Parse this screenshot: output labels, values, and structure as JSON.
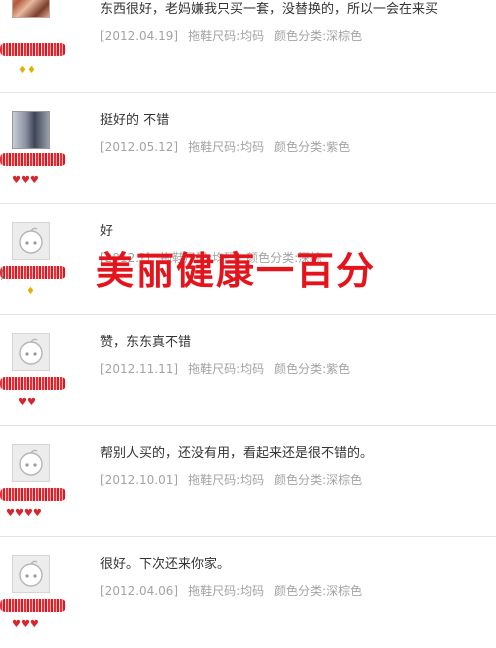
{
  "reviews": [
    {
      "content": "东西很好，老妈嫌我只买一套，没替换的，所以一会在来买",
      "date": "[2012.04.19]",
      "size": "拖鞋尺码:均码",
      "color": "颜色分类:深棕色",
      "avatar": "photo-hair",
      "rank_icon": "diamond-icon",
      "rank_count": 2,
      "rank_glyph": "♦♦",
      "rank_color": "#e2b100"
    },
    {
      "content": "挺好的 不错",
      "date": "[2012.05.12]",
      "size": "拖鞋尺码:均码",
      "color": "颜色分类:紫色",
      "avatar": "photo-room",
      "rank_icon": "heart-icon",
      "rank_count": 3,
      "rank_glyph": "♥♥♥",
      "rank_color": "#d8262d"
    },
    {
      "content": "好",
      "date": "[2012.?]",
      "size": "拖鞋尺码:均码",
      "color": "颜色分类:深棕",
      "avatar": "default",
      "rank_icon": "diamond-icon",
      "rank_count": 1,
      "rank_glyph": "♦",
      "rank_color": "#e2b100"
    },
    {
      "content": "赞，东东真不错",
      "date": "[2012.11.11]",
      "size": "拖鞋尺码:均码",
      "color": "颜色分类:紫色",
      "avatar": "default",
      "rank_icon": "heart-icon",
      "rank_count": 2,
      "rank_glyph": "♥♥",
      "rank_color": "#d8262d"
    },
    {
      "content": "帮别人买的，还没有用，看起来还是很不错的。",
      "date": "[2012.10.01]",
      "size": "拖鞋尺码:均码",
      "color": "颜色分类:深棕色",
      "avatar": "default",
      "rank_icon": "heart-icon",
      "rank_count": 4,
      "rank_glyph": "♥♥♥♥",
      "rank_color": "#d8262d"
    },
    {
      "content": "很好。下次还来你家。",
      "date": "[2012.04.06]",
      "size": "拖鞋尺码:均码",
      "color": "颜色分类:深棕色",
      "avatar": "default",
      "rank_icon": "heart-icon",
      "rank_count": 3,
      "rank_glyph": "♥♥♥",
      "rank_color": "#d8262d"
    }
  ],
  "watermark": "美丽健康一百分",
  "stray_text": ")"
}
